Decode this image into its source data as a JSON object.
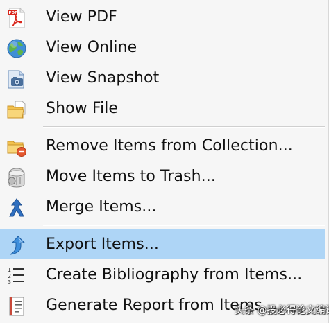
{
  "menu": {
    "items": [
      {
        "label": "View PDF",
        "icon": "pdf-icon"
      },
      {
        "label": "View Online",
        "icon": "globe-icon"
      },
      {
        "label": "View Snapshot",
        "icon": "snapshot-icon"
      },
      {
        "label": "Show File",
        "icon": "folder-icon"
      },
      {
        "label": "Remove Items from Collection...",
        "icon": "remove-from-collection-icon"
      },
      {
        "label": "Move Items to Trash...",
        "icon": "trash-icon"
      },
      {
        "label": "Merge Items...",
        "icon": "merge-icon"
      },
      {
        "label": "Export Items...",
        "icon": "export-icon",
        "highlighted": true
      },
      {
        "label": "Create Bibliography from Items...",
        "icon": "bibliography-icon"
      },
      {
        "label": "Generate Report from Items...",
        "icon": "report-icon"
      }
    ]
  },
  "watermark": {
    "text": "头条 @投必得论文编译"
  },
  "colors": {
    "menu_background": "#f6f6f6",
    "highlight": "#aed5f6",
    "separator": "#cfcfcf",
    "text": "#111111"
  }
}
